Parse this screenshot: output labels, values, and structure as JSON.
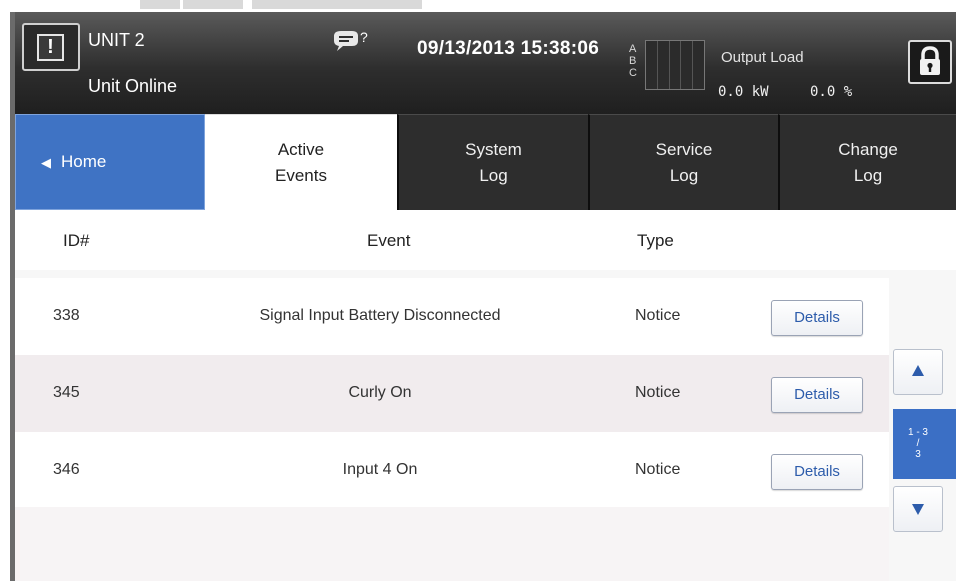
{
  "header": {
    "unit_name": "UNIT 2",
    "unit_status": "Unit Online",
    "alarm_symbol": "!",
    "message_icon": "message-help-icon",
    "message_badge": "?",
    "datetime": "09/13/2013 15:38:06",
    "phases": [
      "A",
      "B",
      "C"
    ],
    "output_label": "Output Load",
    "output_kw": "0.0 kW",
    "output_percent": "0.0 %",
    "lock_icon": "lock-icon"
  },
  "tabs": {
    "home": "Home",
    "active_events": "Active\nEvents",
    "system_log": "System\nLog",
    "service_log": "Service\nLog",
    "change_log": "Change\nLog"
  },
  "table": {
    "columns": {
      "id": "ID#",
      "event": "Event",
      "type": "Type"
    },
    "rows": [
      {
        "id": "338",
        "event": "Signal Input Battery Disconnected",
        "type": "Notice",
        "action": "Details"
      },
      {
        "id": "345",
        "event": "Curly On",
        "type": "Notice",
        "action": "Details"
      },
      {
        "id": "346",
        "event": "Input 4 On",
        "type": "Notice",
        "action": "Details"
      }
    ]
  },
  "pager": {
    "range": "1 - 3",
    "separator": "/",
    "total": "3"
  },
  "colors": {
    "accent_blue": "#3f73c4",
    "header_dark": "#2e2e2e",
    "tab_dark": "#2d2d2d",
    "link_blue": "#2d5cab"
  }
}
